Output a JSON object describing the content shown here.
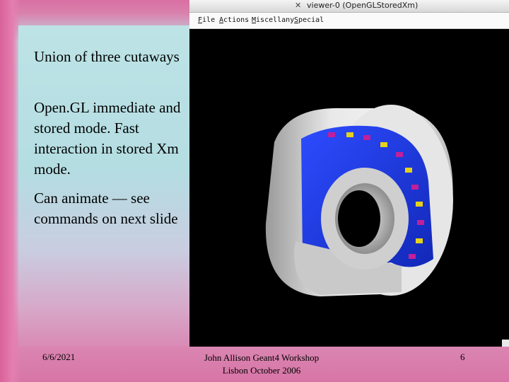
{
  "slide": {
    "paragraphs": [
      "Union of three cutaways",
      "Open.GL immediate and stored mode. Fast interaction in stored Xm mode.",
      "Can animate — see commands on next slide"
    ],
    "footer": {
      "date": "6/6/2021",
      "center_line1": "John Allison  Geant4 Workshop",
      "center_line2": "Lisbon  October 2006",
      "page": "6"
    }
  },
  "viewer": {
    "window_title": "viewer-0 (OpenGLStoredXm)",
    "title_icon": "x11-icon",
    "menus": [
      "File",
      "Actions",
      "Miscellany",
      "Special"
    ]
  },
  "colors": {
    "detector_blue": "#1f3fe8",
    "cylinder_grey": "#dcdcdc",
    "background": "#000000"
  }
}
